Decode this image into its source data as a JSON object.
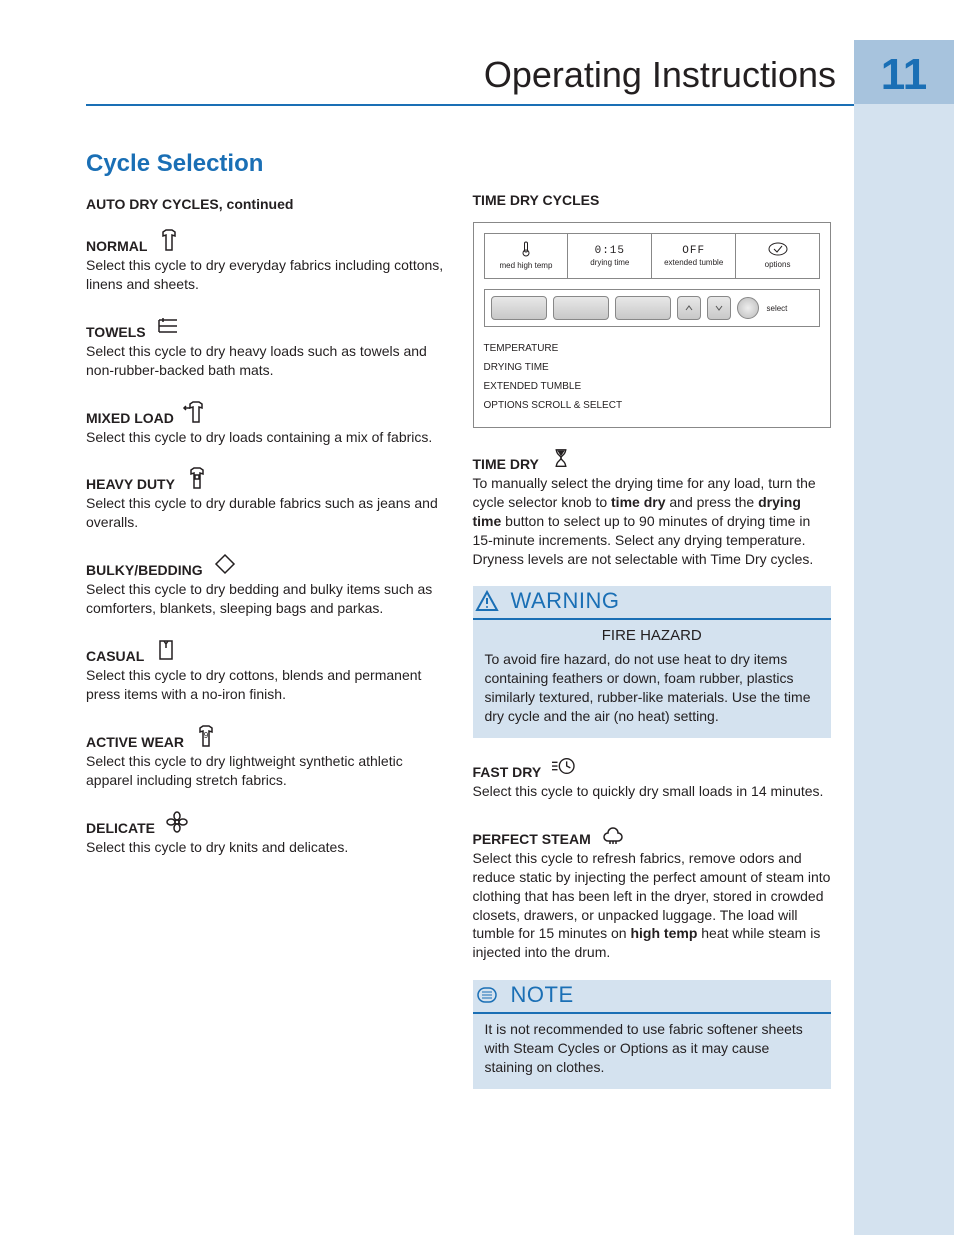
{
  "header": {
    "title": "Operating Instructions",
    "page_number": "11"
  },
  "section_title": "Cycle Selection",
  "left": {
    "subhead": "AUTO DRY CYCLES, continued",
    "cycles": [
      {
        "name": "NORMAL",
        "icon": "shirt-icon",
        "desc": "Select this cycle to dry everyday fabrics including cottons, linens and sheets."
      },
      {
        "name": "TOWELS",
        "icon": "towels-icon",
        "desc": "Select this cycle to dry heavy loads such as towels and non-rubber-backed bath mats."
      },
      {
        "name": "MIXED LOAD",
        "icon": "mixed-load-icon",
        "desc": "Select this cycle to dry loads containing a mix of fabrics."
      },
      {
        "name": "HEAVY DUTY",
        "icon": "heavy-duty-icon",
        "desc": "Select this cycle to dry durable fabrics such as jeans and overalls."
      },
      {
        "name": "BULKY/BEDDING",
        "icon": "bedding-icon",
        "desc": "Select this cycle to dry bedding and bulky items such as comforters, blankets, sleeping bags and parkas."
      },
      {
        "name": "CASUAL",
        "icon": "casual-icon",
        "desc": "Select this cycle to dry cottons, blends and permanent press items with a no-iron finish."
      },
      {
        "name": "ACTIVE WEAR",
        "icon": "activewear-icon",
        "desc": "Select this cycle to dry lightweight synthetic athletic apparel including stretch fabrics."
      },
      {
        "name": "DELICATE",
        "icon": "delicate-icon",
        "desc": "Select this cycle to dry knits and delicates."
      }
    ]
  },
  "right": {
    "subhead": "TIME DRY CYCLES",
    "diagram": {
      "lcd": [
        {
          "top_icon": "thermometer-icon",
          "bot": "med high temp"
        },
        {
          "top": "0:15",
          "bot": "drying time"
        },
        {
          "top": "OFF",
          "bot": "extended tumble"
        },
        {
          "top_icon": "options-icon",
          "bot": "options"
        }
      ],
      "select_label": "select",
      "callouts": [
        "TEMPERATURE",
        "DRYING TIME",
        "EXTENDED TUMBLE",
        "OPTIONS SCROLL & SELECT"
      ]
    },
    "time_dry": {
      "name": "TIME DRY",
      "icon": "hourglass-icon",
      "p1": "To manually select the drying time for any load, turn the cycle selector knob to ",
      "b1": "time dry",
      "p2": " and press the ",
      "b2": "drying time",
      "p3": " button to select up to 90 minutes of drying time in 15-minute increments. Select any drying temperature. Dryness levels are not selectable with Time Dry cycles."
    },
    "warning": {
      "title": "WARNING",
      "sub": "FIRE HAZARD",
      "body": "To avoid fire hazard, do not use heat to dry items containing feathers or down, foam rubber, plastics similarly textured, rubber-like materials. Use the time dry cycle and the air (no heat) setting."
    },
    "fast_dry": {
      "name": "FAST DRY",
      "icon": "fast-dry-icon",
      "desc": "Select this cycle to quickly dry small loads in 14 minutes."
    },
    "perfect_steam": {
      "name": "PERFECT STEAM",
      "icon": "steam-icon",
      "p1": "Select this cycle to refresh fabrics, remove odors and reduce static by injecting the perfect amount of steam into clothing that has been left in the dryer, stored in crowded closets, drawers, or unpacked luggage. The load will tumble for 15 minutes on ",
      "b1": "high temp",
      "p2": " heat while steam is injected into the drum."
    },
    "note": {
      "title": "NOTE",
      "body": "It is not recommended to use fabric softener sheets with Steam Cycles or Options as it may cause staining on clothes."
    }
  }
}
